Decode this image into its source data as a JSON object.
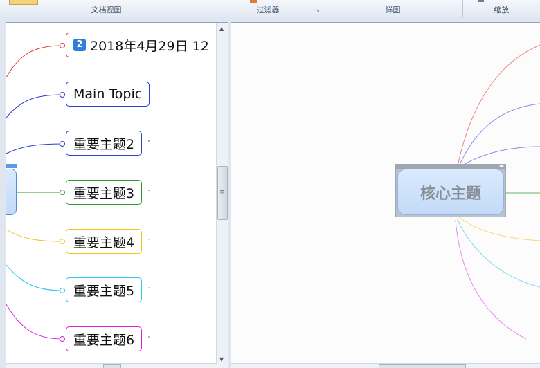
{
  "ribbon": {
    "groups": [
      {
        "label": "文档视图"
      },
      {
        "label": "过滤器"
      },
      {
        "label": "详图"
      },
      {
        "label": "缩放"
      }
    ]
  },
  "outline_pane": {
    "topics": [
      {
        "text": "2018年4月29日 12",
        "badge": "2",
        "color": "#e8322c"
      },
      {
        "text": "Main Topic",
        "color": "#2b3fd0"
      },
      {
        "text": "重要主题2",
        "color": "#2b3fd0"
      },
      {
        "text": "重要主题3",
        "color": "#2c9a2c"
      },
      {
        "text": "重要主题4",
        "color": "#f0c419"
      },
      {
        "text": "重要主题5",
        "color": "#27c8e8"
      },
      {
        "text": "重要主题6",
        "color": "#e020e0"
      }
    ]
  },
  "map_pane": {
    "central_topic": "核心主题"
  }
}
